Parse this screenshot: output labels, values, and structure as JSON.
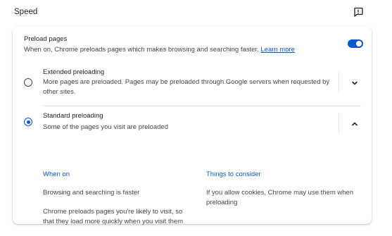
{
  "section": {
    "title": "Speed",
    "feedback_icon": "feedback-icon"
  },
  "preload": {
    "title": "Preload pages",
    "description": "When on, Chrome preloads pages which makes browsing and searching faster.",
    "learn_more": "Learn more",
    "toggle_state": "on",
    "accent_color": "#0b57d0"
  },
  "options": [
    {
      "title": "Extended preloading",
      "description": "More pages are preloaded. Pages may be preloaded through Google servers when requested by other sites.",
      "selected": false,
      "expanded": false,
      "expand_icon": "chevron-down-icon"
    },
    {
      "title": "Standard preloading",
      "description": "Some of the pages you visit are preloaded",
      "selected": true,
      "expanded": true,
      "expand_icon": "chevron-up-icon",
      "details": {
        "when_on": {
          "heading": "When on",
          "items": [
            "Browsing and searching is faster",
            "Chrome preloads pages you're likely to visit, so that they load more quickly when you visit them"
          ]
        },
        "things_to_consider": {
          "heading": "Things to consider",
          "items": [
            "If you allow cookies, Chrome may use them when preloading"
          ]
        }
      }
    }
  ]
}
